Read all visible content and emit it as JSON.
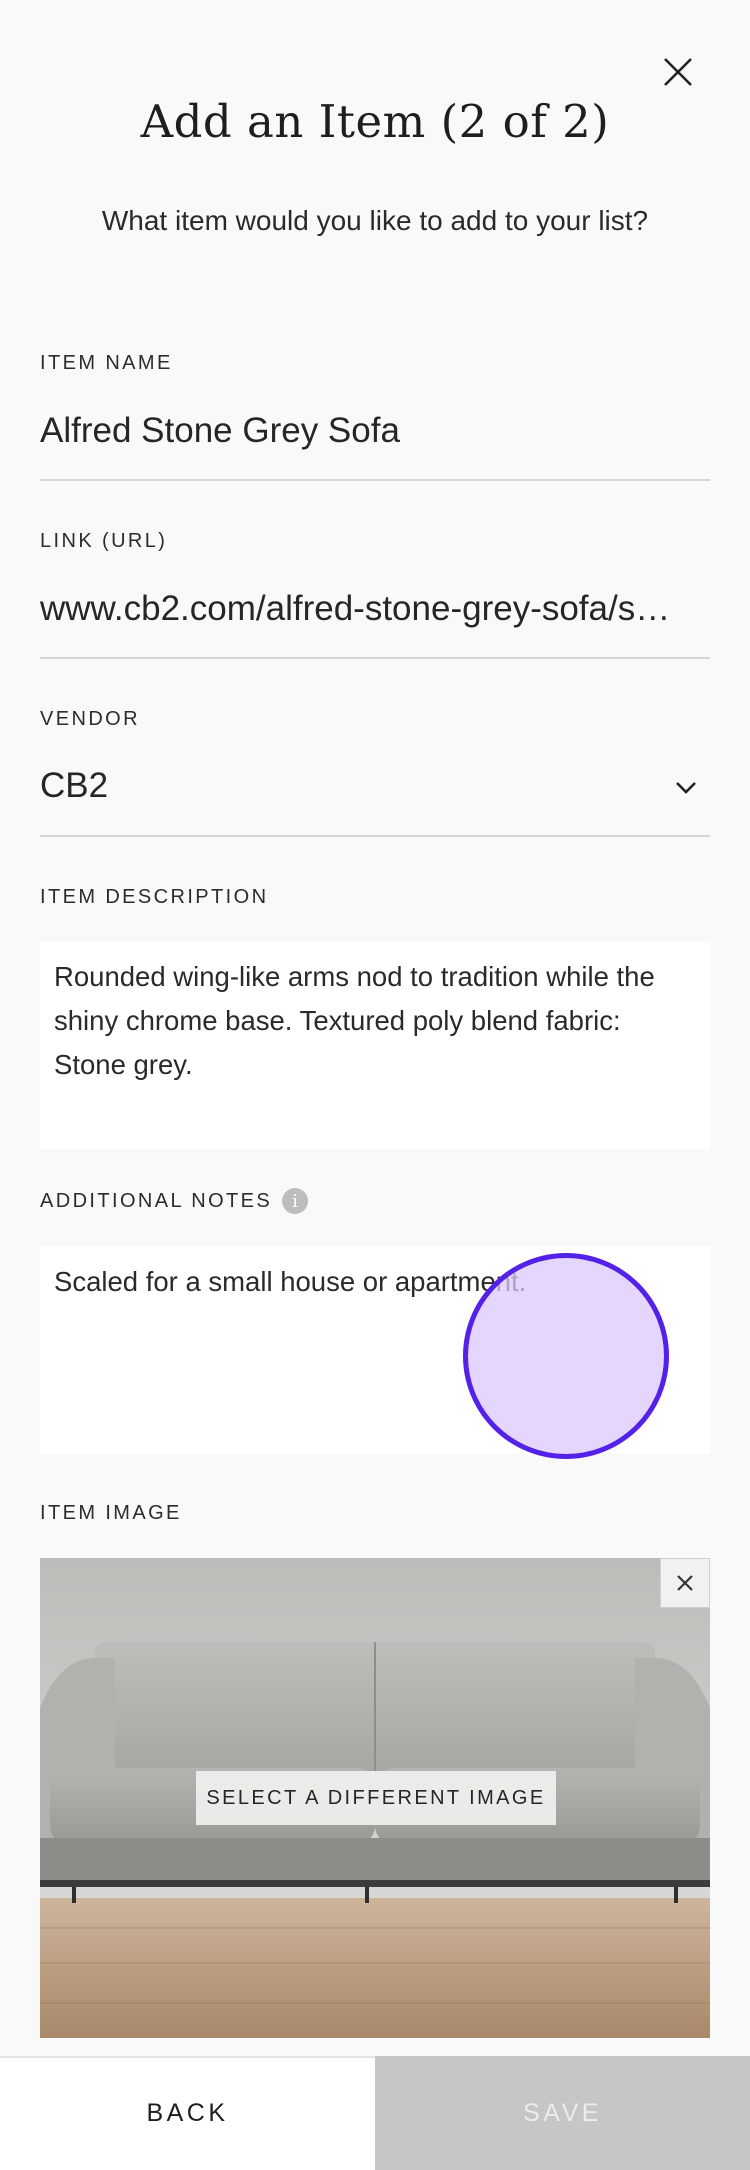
{
  "modal": {
    "title": "Add an Item (2 of 2)",
    "subtitle": "What item would you like to add to your list?"
  },
  "fields": {
    "item_name": {
      "label": "ITEM NAME",
      "value": "Alfred Stone Grey Sofa"
    },
    "link": {
      "label": "LINK (URL)",
      "value": "www.cb2.com/alfred-stone-grey-sofa/s…"
    },
    "vendor": {
      "label": "VENDOR",
      "value": "CB2"
    },
    "description": {
      "label": "ITEM DESCRIPTION",
      "value": "Rounded wing-like arms nod to tradition while the shiny chrome base. Textured poly blend fabric: Stone grey."
    },
    "notes": {
      "label": "ADDITIONAL NOTES",
      "value": "Scaled for a small house or apartment."
    },
    "image": {
      "label": "ITEM IMAGE",
      "select_label": "SELECT A DIFFERENT IMAGE"
    }
  },
  "footer": {
    "back_label": "BACK",
    "save_label": "SAVE"
  },
  "icons": {
    "close": "close-icon",
    "dropdown": "chevron-down-icon",
    "info": "info-icon",
    "remove_image": "close-icon"
  },
  "colors": {
    "background": "#f9f9f9",
    "save_disabled": "#c6c6c6",
    "touch_indicator": "#5421e8"
  }
}
